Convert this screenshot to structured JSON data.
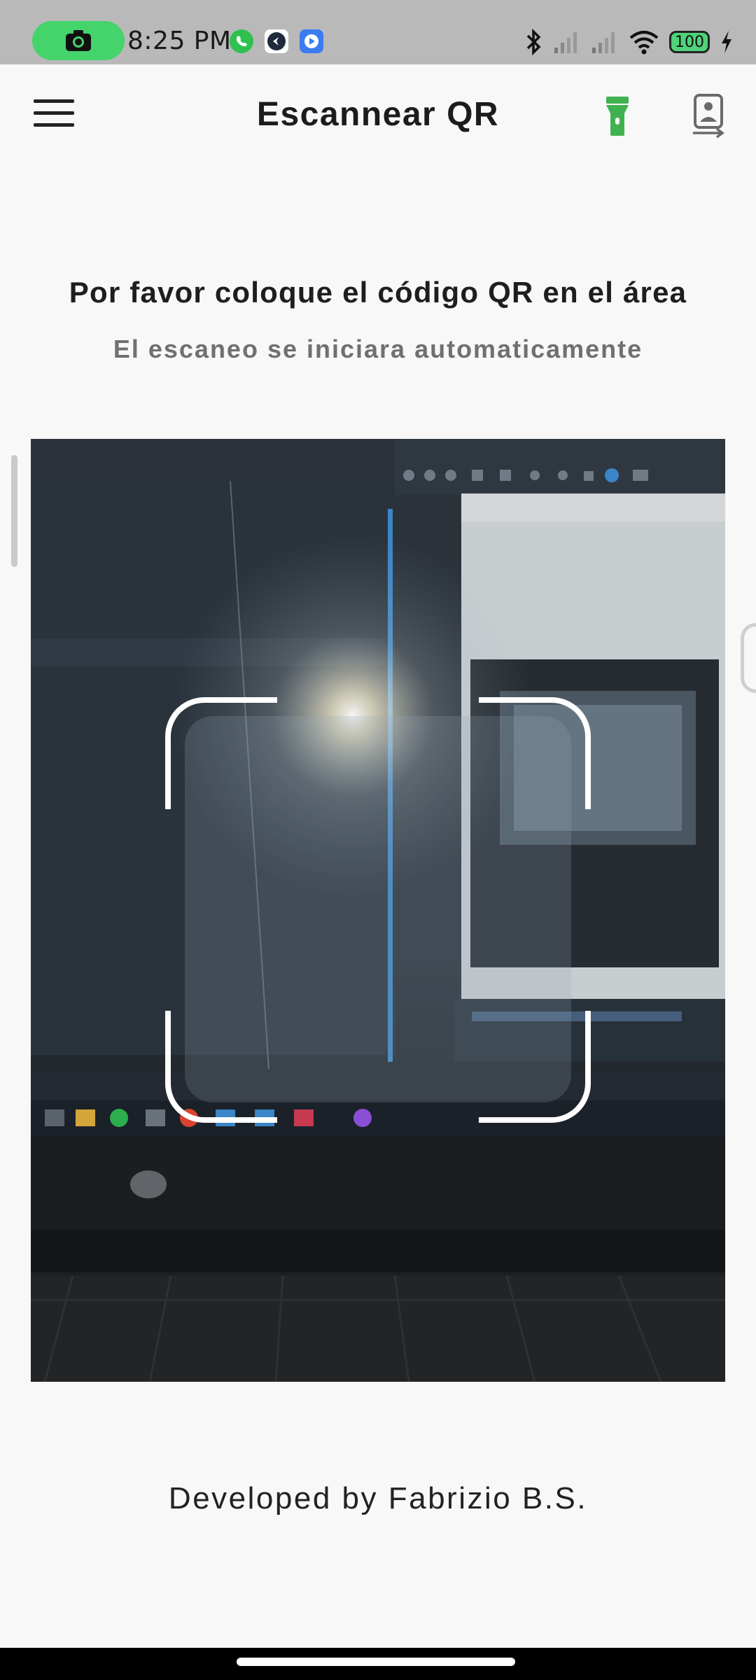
{
  "status_bar": {
    "time": "8:25 PM",
    "battery": "100",
    "left_icons": [
      "camera-icon",
      "whatsapp-icon",
      "app-icon",
      "screen-recorder-icon"
    ],
    "right_icons": [
      "bluetooth-icon",
      "signal-icon",
      "signal-icon",
      "wifi-icon",
      "battery-icon",
      "charging-icon"
    ],
    "pill_color": "#45d36c"
  },
  "app_bar": {
    "title": "Escannear QR",
    "menu_icon": "menu-icon",
    "torch_icon": "flashlight-icon",
    "torch_color": "#3fb24f",
    "switch_camera_icon": "switch-camera-icon"
  },
  "instructions": {
    "primary": "Por favor coloque el código QR en el área",
    "secondary": "El escaneo se iniciara automaticamente"
  },
  "scanner": {
    "frame_color": "#ffffff"
  },
  "footer": {
    "credit": "Developed by Fabrizio B.S."
  }
}
